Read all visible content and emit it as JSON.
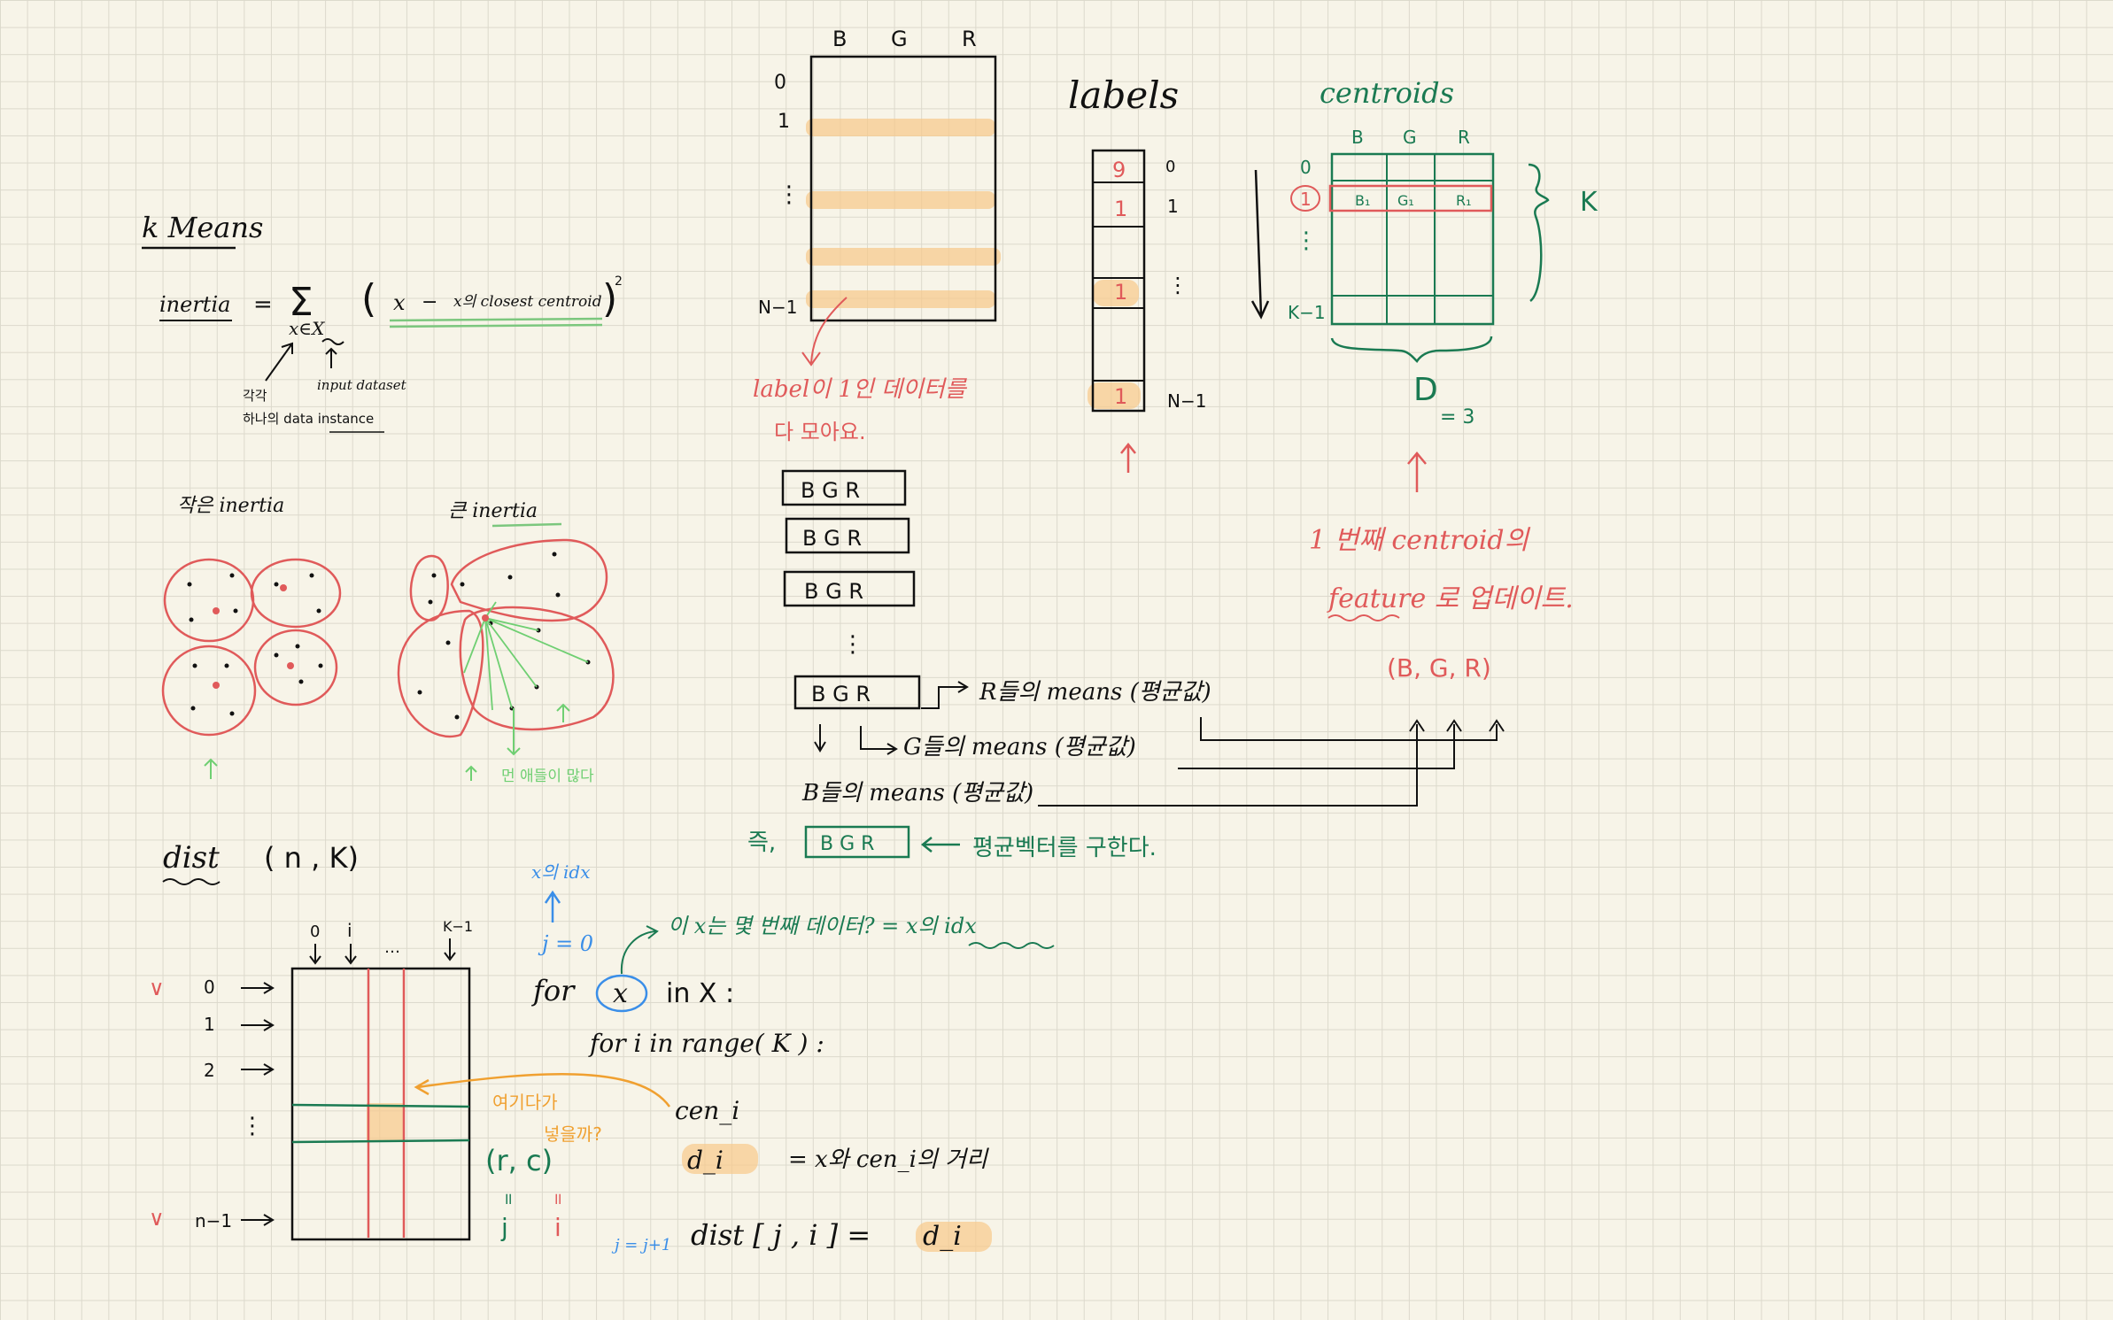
{
  "kmeans": {
    "title": "k Means",
    "inertia_lhs": "inertia",
    "equals": "=",
    "sigma": "Σ",
    "sum_index": "x∈X",
    "term_x": "x",
    "minus": "−",
    "term_centroid": "x의 closest centroid",
    "square": "2",
    "note_each_1": "각각",
    "note_each_2": "하나의 data instance",
    "note_input": "input dataset"
  },
  "clusters": {
    "small_label": "작은 inertia",
    "big_label": "큰 inertia",
    "far_note": "먼 애들이 많다"
  },
  "data_matrix": {
    "col_b": "B",
    "col_g": "G",
    "col_r": "R",
    "row_0": "0",
    "row_1": "1",
    "row_dots": "⋮",
    "row_last": "N−1",
    "caption_1": "label이 1인 데이터를",
    "caption_2": "다 모아요.",
    "row_bgr": "B  G  R",
    "vdots": "⋮"
  },
  "labels_col": {
    "title": "labels",
    "values": [
      "9",
      "1",
      "1",
      "1"
    ],
    "idx_0": "0",
    "idx_1": "1",
    "idx_dots": "⋮",
    "idx_last": "N−1"
  },
  "means": {
    "r_means": "R들의 means (평균값)",
    "g_means": "G들의 means (평균값)",
    "b_means": "B들의 means (평균값)",
    "result_prefix": "즉,",
    "result_vec": "B G R",
    "result_text": "평균벡터를 구한다."
  },
  "centroids": {
    "title": "centroids",
    "col_b": "B",
    "col_g": "G",
    "col_r": "R",
    "row_0": "0",
    "row_1": "1",
    "row_last": "K−1",
    "b1": "B₁",
    "g1": "G₁",
    "r1": "R₁",
    "k_label": "K",
    "d_label": "D",
    "d_value": "= 3",
    "note_1": "1 번째 centroid의",
    "note_2": "feature 로 업데이트.",
    "tuple": "(B, G, R)"
  },
  "dist": {
    "title": "dist",
    "shape": "( n , K)",
    "col_0": "0",
    "col_i": "i",
    "col_dots": "…",
    "col_last": "K−1",
    "row_0": "0",
    "row_1": "1",
    "row_2": "2",
    "row_dots": "⋮",
    "row_last": "n−1",
    "check": "∨",
    "where_note_1": "여기다가",
    "where_note_2": "넣을까?",
    "rc": "(r, c)",
    "j": "j",
    "i": "i"
  },
  "code": {
    "x_idx_note": "x의 idx",
    "j_init": "j = 0",
    "which_note": "이 x는 몇 번째 데이터? = x의 idx",
    "line1_for": "for",
    "line1_x": "x",
    "line1_rest": "in  X :",
    "line2": "for   i   in  range( K ) :",
    "line3": "cen_i",
    "line4_d": "d_i",
    "line4_rest": "=  x와  cen_i의 거리",
    "j_incr": "j = j+1",
    "line5_left": "dist [ j , i ]  =",
    "line5_d": "d_i"
  }
}
